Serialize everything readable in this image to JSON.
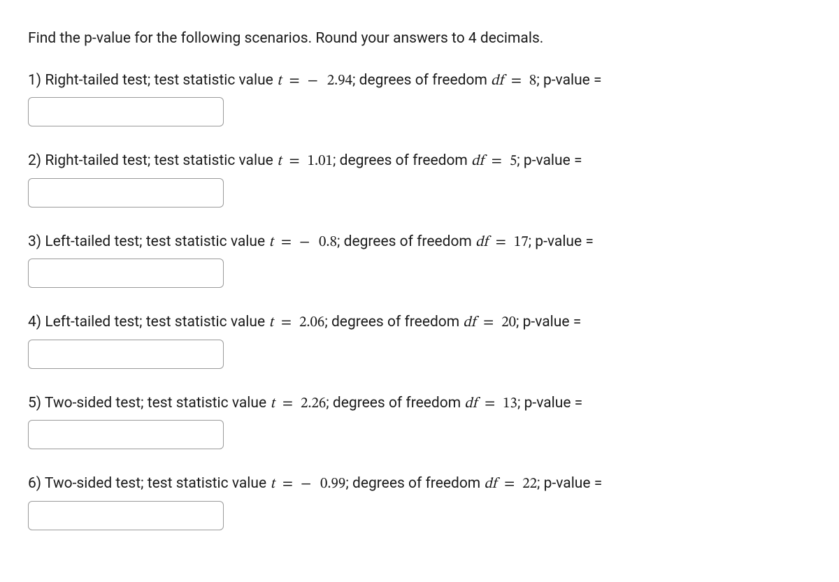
{
  "instructions": "Find the p-value for the following scenarios. Round your answers to 4 decimals.",
  "labels": {
    "test_stat_prefix": "test statistic value ",
    "t_var": "t",
    "eq": " = ",
    "neg": " − ",
    "df_prefix": "; degrees of freedom ",
    "df_var": "df",
    "df_eq": " = ",
    "pvalue_suffix": "; p-value ="
  },
  "questions": [
    {
      "num": "1) ",
      "test_type": "Right-tailed test; ",
      "negative": true,
      "t_value": "2.94",
      "df": "8"
    },
    {
      "num": "2) ",
      "test_type": "Right-tailed test; ",
      "negative": false,
      "t_value": "1.01",
      "df": "5"
    },
    {
      "num": "3) ",
      "test_type": "Left-tailed test; ",
      "negative": true,
      "t_value": "0.8",
      "df": "17"
    },
    {
      "num": "4) ",
      "test_type": "Left-tailed test; ",
      "negative": false,
      "t_value": "2.06",
      "df": "20"
    },
    {
      "num": "5) ",
      "test_type": "Two-sided test; ",
      "negative": false,
      "t_value": "2.26",
      "df": "13"
    },
    {
      "num": "6) ",
      "test_type": "Two-sided test; ",
      "negative": true,
      "t_value": "0.99",
      "df": "22"
    }
  ]
}
